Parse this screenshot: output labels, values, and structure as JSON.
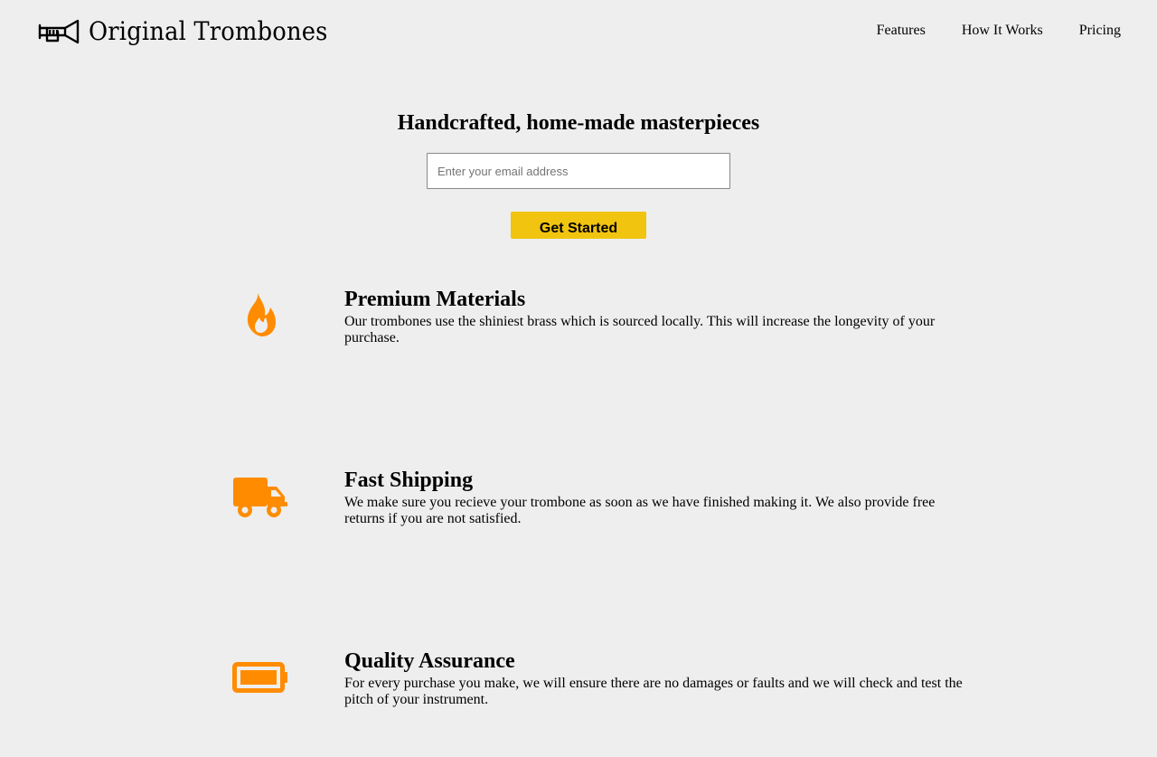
{
  "header": {
    "brand": "Original Trombones",
    "logo_icon": "trombone-logo-icon",
    "nav": [
      {
        "label": "Features"
      },
      {
        "label": "How It Works"
      },
      {
        "label": "Pricing"
      }
    ]
  },
  "hero": {
    "title": "Handcrafted, home-made masterpieces",
    "email_placeholder": "Enter your email address",
    "email_value": "",
    "cta_label": "Get Started"
  },
  "features": [
    {
      "icon": "fire-icon",
      "title": "Premium Materials",
      "description": "Our trombones use the shiniest brass which is sourced locally. This will increase the longevity of your purchase."
    },
    {
      "icon": "truck-icon",
      "title": "Fast Shipping",
      "description": "We make sure you recieve your trombone as soon as we have finished making it. We also provide free returns if you are not satisfied."
    },
    {
      "icon": "battery-full-icon",
      "title": "Quality Assurance",
      "description": "For every purchase you make, we will ensure there are no damages or faults and we will check and test the pitch of your instrument."
    }
  ],
  "colors": {
    "background": "#eeeeee",
    "accent_button": "#f1c40f",
    "icon_orange": "#ff8c00"
  }
}
